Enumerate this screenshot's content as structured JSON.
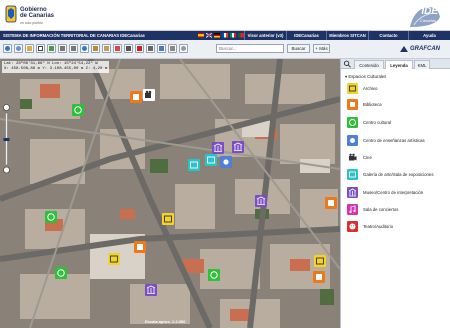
{
  "header": {
    "gov_title_line1": "Gobierno",
    "gov_title_line2": "de Canarias",
    "gov_subtitle": "un solo pueblo",
    "ide_logo": "IDE",
    "ide_logo_sub": "Canarias"
  },
  "navbar": {
    "system_title": "SISTEMA DE INFORMACIÓN TERRITORIAL DE CANARIAS   IDECanarias",
    "buttons": [
      "Visor anterior (v3)",
      "IDECanarias",
      "Miembros SITCAN",
      "Contacto",
      "Ayuda"
    ],
    "flags": [
      "flag-es",
      "flag-en",
      "flag-de",
      "flag-fr",
      "flag-it",
      "flag-pt"
    ]
  },
  "toolbar": {
    "search_placeholder": "Buscar...",
    "search_button": "Buscar",
    "more_button": "Más",
    "brand": "GRAFCAN"
  },
  "map": {
    "coords_line1": "Lat: 28º06'31,66\" N  Lon: 15º24'54,22\" W",
    "coords_line2": "X: 458.508,86 m  Y: 3.108.455,00 m  Z: 4,20 m",
    "scale_text": "Escala aprox. 1:2.000"
  },
  "panel": {
    "tabs": [
      "Contenido",
      "Leyenda",
      "KML"
    ],
    "active_tab": "Leyenda",
    "section_title": "Espacios Culturales",
    "legend": [
      {
        "label": "Archivo",
        "icon": "archive-icon",
        "color": "#f2d22b"
      },
      {
        "label": "Biblioteca",
        "icon": "library-icon",
        "color": "#ec7a1c"
      },
      {
        "label": "Centro cultural",
        "icon": "cultural-center-icon",
        "color": "#2fbf3a"
      },
      {
        "label": "Centro de enseñanzas artísticas",
        "icon": "art-school-icon",
        "color": "#4f7fd6"
      },
      {
        "label": "Cine",
        "icon": "cinema-icon",
        "color": "#ffffff"
      },
      {
        "label": "Galería de arte/Sala de exposiciones",
        "icon": "gallery-icon",
        "color": "#29c3c9"
      },
      {
        "label": "Museo/Centro de interpretación",
        "icon": "museum-icon",
        "color": "#7a4fc1"
      },
      {
        "label": "Sala de conciertos",
        "icon": "concert-hall-icon",
        "color": "#d92fb1"
      },
      {
        "label": "Teatro/Auditorio",
        "icon": "theatre-icon",
        "color": "#d92f2f"
      }
    ]
  },
  "colors": {
    "nav_bg": "#1d3265",
    "panel_tab_bg": "#dfe5ee"
  }
}
